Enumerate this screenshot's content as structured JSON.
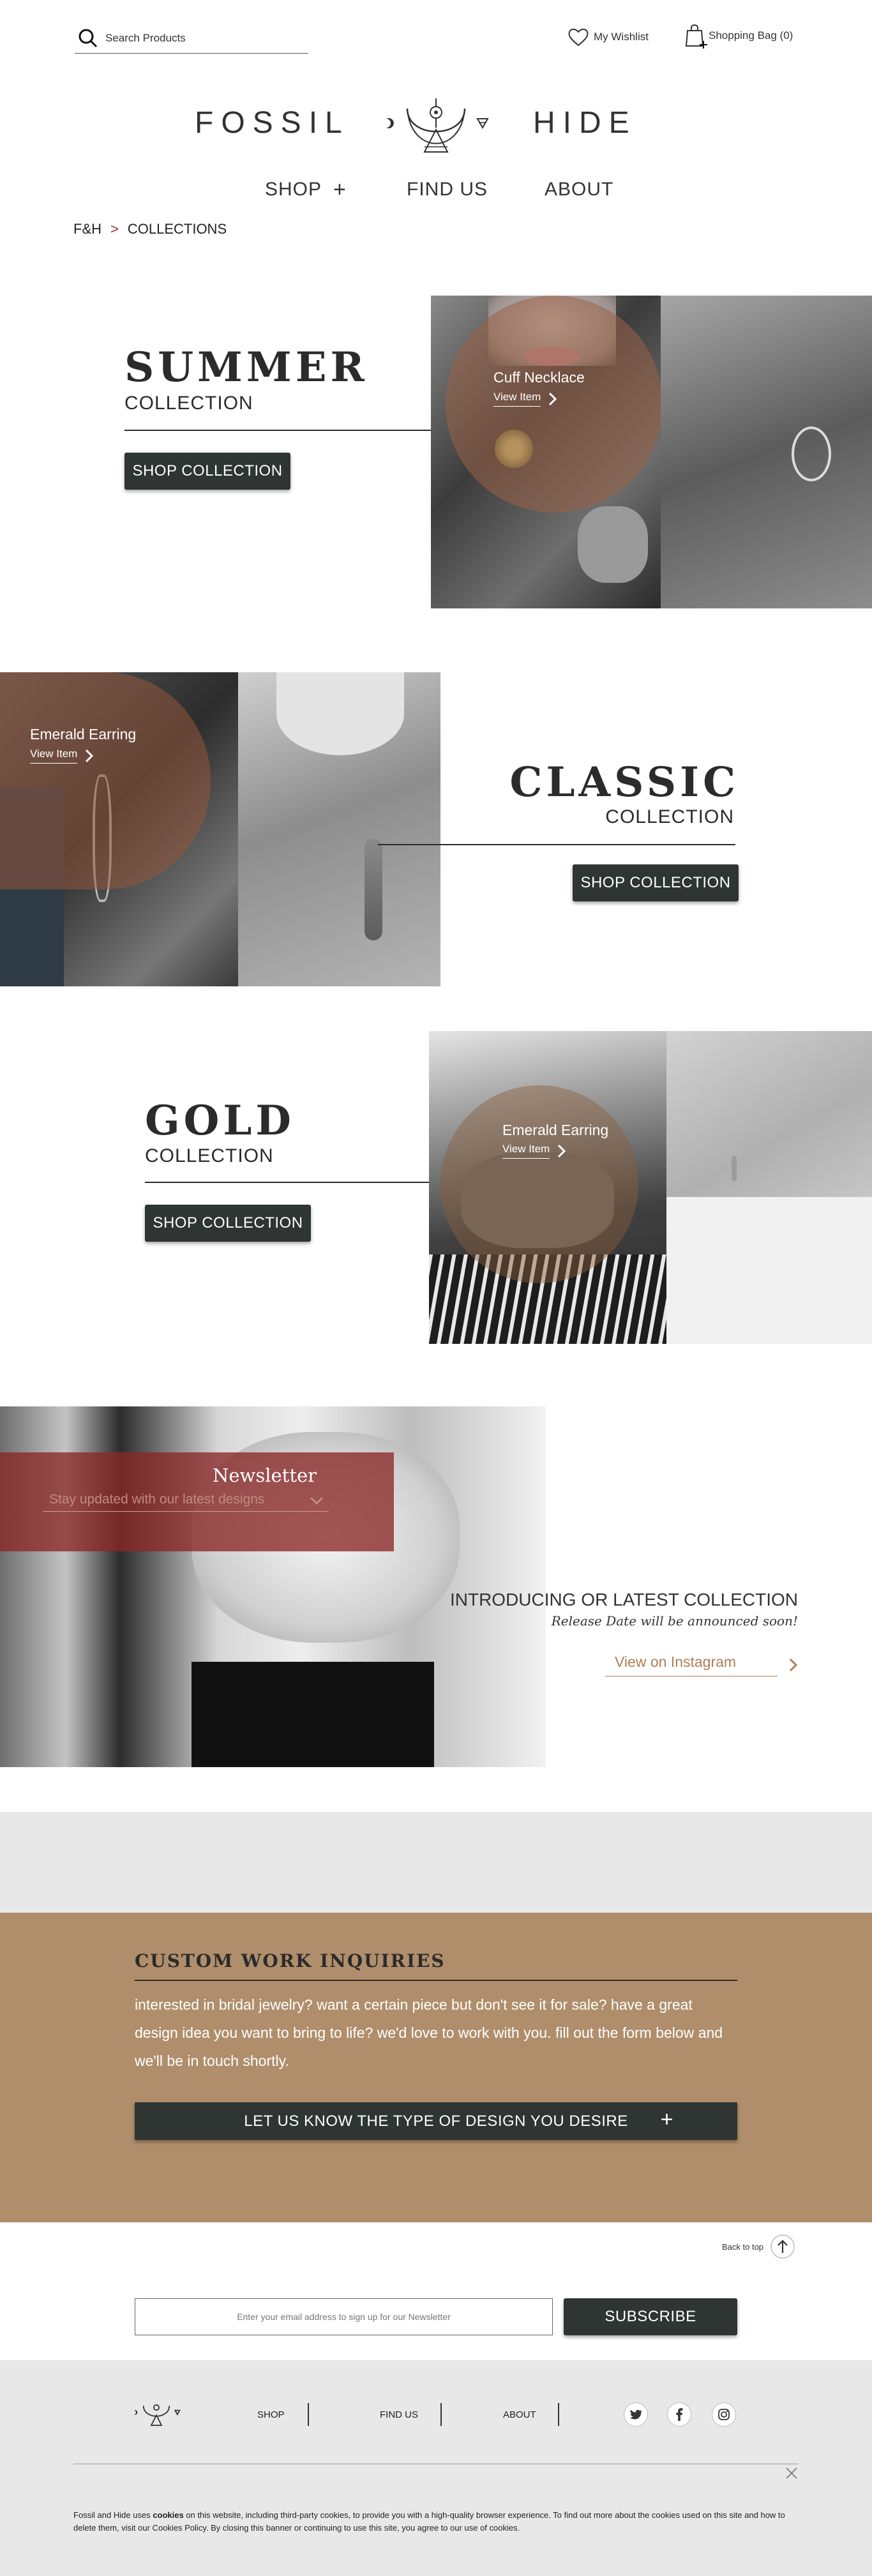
{
  "header": {
    "search_placeholder": "Search Products",
    "wishlist_label": "My Wishlist",
    "bag_label": "Shopping Bag (0)",
    "brand_left": "FOSSIL",
    "brand_right": "HIDE"
  },
  "nav": {
    "shop": "SHOP",
    "shop_toggle": "+",
    "find_us": "FIND US",
    "about": "ABOUT"
  },
  "breadcrumb": {
    "home": "F&H",
    "separator": ">",
    "current": "COLLECTIONS"
  },
  "collections": [
    {
      "title": "SUMMER",
      "subtitle": "COLLECTION",
      "button": "SHOP COLLECTION",
      "item_name": "Cuff Necklace",
      "item_link": "View Item"
    },
    {
      "title": "CLASSIC",
      "subtitle": "COLLECTION",
      "button": "SHOP COLLECTION",
      "item_name": "Emerald Earring",
      "item_link": "View Item"
    },
    {
      "title": "GOLD",
      "subtitle": "COLLECTION",
      "button": "SHOP COLLECTION",
      "item_name": "Emerald Earring",
      "item_link": "View Item"
    }
  ],
  "newsletter": {
    "title": "Newsletter",
    "placeholder": "Stay updated with our latest designs"
  },
  "introducing": {
    "title": "INTRODUCING OR LATEST COLLECTION",
    "subtitle": "Release Date will be announced soon!",
    "link": "View on Instagram"
  },
  "custom_work": {
    "title": "CUSTOM WORK INQUIRIES",
    "body": "interested in bridal jewelry? want a certain piece but don't see it for sale? have a great design idea you want to bring to life? we'd love to work with you. fill out the form below and we'll be in touch shortly.",
    "button": "LET US KNOW THE TYPE OF DESIGN YOU DESIRE",
    "button_icon": "+"
  },
  "back_to_top": "Back to top",
  "subscribe": {
    "placeholder": "Enter your email address to sign up for our Newsletter",
    "button": "SUBSCRIBE"
  },
  "footer": {
    "shop": "SHOP",
    "find_us": "FIND US",
    "about": "ABOUT",
    "social": [
      "twitter-icon",
      "facebook-icon",
      "instagram-icon"
    ]
  },
  "cookie": {
    "before": "Fossil and Hide uses ",
    "bold": "cookies",
    "after": " on this website, including third-party cookies, to provide you with a high-quality browser experience. To find out more about the cookies used on this site and how to delete them, visit our Cookies Policy. By closing this banner or continuing to use this site, you agree to our use of cookies."
  },
  "colors": {
    "dark_button": "#2e3532",
    "tan_section": "#b08e6b",
    "grey_band": "#e8e8e8",
    "newsletter_overlay": "#8a3a3a",
    "accent_link": "#b07d55"
  }
}
